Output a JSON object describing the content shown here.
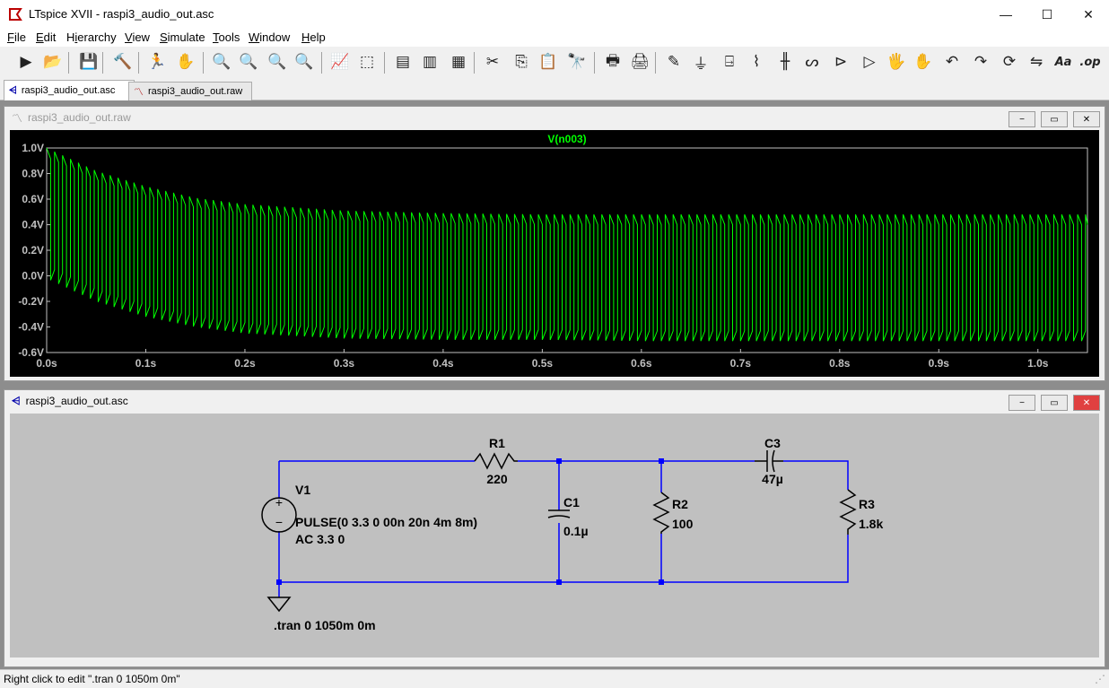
{
  "window": {
    "title": "LTspice XVII - raspi3_audio_out.asc"
  },
  "menu": [
    "File",
    "Edit",
    "Hierarchy",
    "View",
    "Simulate",
    "Tools",
    "Window",
    "Help"
  ],
  "menu_underline": [
    "F",
    "E",
    "i",
    "V",
    "S",
    "T",
    "W",
    "H"
  ],
  "toolbar_icons": [
    "run-icon",
    "open-folder-icon",
    "save-icon",
    "control-panel-hammer-icon",
    "halt-run-icon",
    "pan-hand-icon",
    "zoom-in-icon",
    "zoom-area-icon",
    "zoom-out-icon",
    "zoom-cancel-icon",
    "autorange-icon",
    "pick-visible-traces-icon",
    "tile-horizontal-icon",
    "cascade-icon",
    "tile-vertical-icon",
    "cut-icon",
    "copy-icon",
    "paste-icon",
    "find-icon",
    "print-preview-icon",
    "print-icon",
    "draw-wire-icon",
    "ground-icon",
    "label-net-icon",
    "resistor-icon",
    "capacitor-icon",
    "inductor-icon",
    "diode-icon",
    "component-icon",
    "move-icon",
    "drag-icon",
    "undo-icon",
    "redo-icon",
    "rotate-icon",
    "mirror-icon",
    "text-icon",
    "spice-directive-icon"
  ],
  "toolbar_glyphs": [
    "▶",
    "📂",
    "💾",
    "🔨",
    "🏃",
    "✋",
    "🔍",
    "🔍",
    "🔍",
    "🔍",
    "📈",
    "⬚",
    "▤",
    "▥",
    "▦",
    "✂",
    "⎘",
    "📋",
    "🔭",
    "🖶",
    "🖨",
    "✎",
    "⏚",
    "⍈",
    "⌇",
    "╫",
    "ᔕ",
    "⊳",
    "▷",
    "🖐",
    "✋",
    "↶",
    "↷",
    "⟳",
    "⇋",
    "Aa",
    ".op"
  ],
  "tabs": [
    {
      "label": "raspi3_audio_out.asc",
      "icon": "schematic-icon",
      "active": true
    },
    {
      "label": "raspi3_audio_out.raw",
      "icon": "waveform-icon",
      "active": false
    }
  ],
  "waveform_window": {
    "title": "raspi3_audio_out.raw",
    "buttons": [
      "−",
      "▭",
      "✕"
    ]
  },
  "schematic_window": {
    "title": "raspi3_audio_out.asc",
    "buttons": [
      "−",
      "▭",
      "✕"
    ]
  },
  "colors": {
    "plot_bg": "#000000",
    "trace": "#00ff00",
    "axis_text": "#c0c0c0",
    "schematic_bg": "#c0c0c0",
    "wire": "#0000ff",
    "component": "#000000"
  },
  "chart_data": {
    "type": "line",
    "title": "V(n003)",
    "series": [
      {
        "name": "V(n003)",
        "description_points": {
          "t": [
            0.0,
            0.05,
            0.1,
            0.15,
            0.2,
            0.3,
            0.4,
            0.5,
            0.6,
            0.8,
            1.05
          ],
          "upper": [
            1.0,
            0.82,
            0.7,
            0.61,
            0.56,
            0.51,
            0.49,
            0.48,
            0.48,
            0.48,
            0.48
          ],
          "lower": [
            -0.02,
            -0.2,
            -0.32,
            -0.4,
            -0.45,
            -0.49,
            -0.5,
            -0.5,
            -0.51,
            -0.51,
            -0.51
          ]
        }
      }
    ],
    "xlim": [
      0.0,
      1.05
    ],
    "ylim": [
      -0.6,
      1.0
    ],
    "x_ticks": [
      "0.0s",
      "0.1s",
      "0.2s",
      "0.3s",
      "0.4s",
      "0.5s",
      "0.6s",
      "0.7s",
      "0.8s",
      "0.9s",
      "1.0s"
    ],
    "y_ticks": [
      "1.0V",
      "0.8V",
      "0.6V",
      "0.4V",
      "0.2V",
      "0.0V",
      "-0.2V",
      "-0.4V",
      "-0.6V"
    ],
    "pulse_period_s": 0.008,
    "grid": false
  },
  "schematic": {
    "V1": {
      "name": "V1",
      "value": "PULSE(0 3.3 0 00n 20n 4m 8m)",
      "ac": "AC 3.3 0"
    },
    "R1": {
      "name": "R1",
      "value": "220"
    },
    "C1": {
      "name": "C1",
      "value": "0.1µ"
    },
    "R2": {
      "name": "R2",
      "value": "100"
    },
    "C3": {
      "name": "C3",
      "value": "47µ"
    },
    "R3": {
      "name": "R3",
      "value": "1.8k"
    },
    "directive": ".tran 0 1050m 0m"
  },
  "status": {
    "text": "Right click to edit \".tran 0 1050m 0m\""
  }
}
